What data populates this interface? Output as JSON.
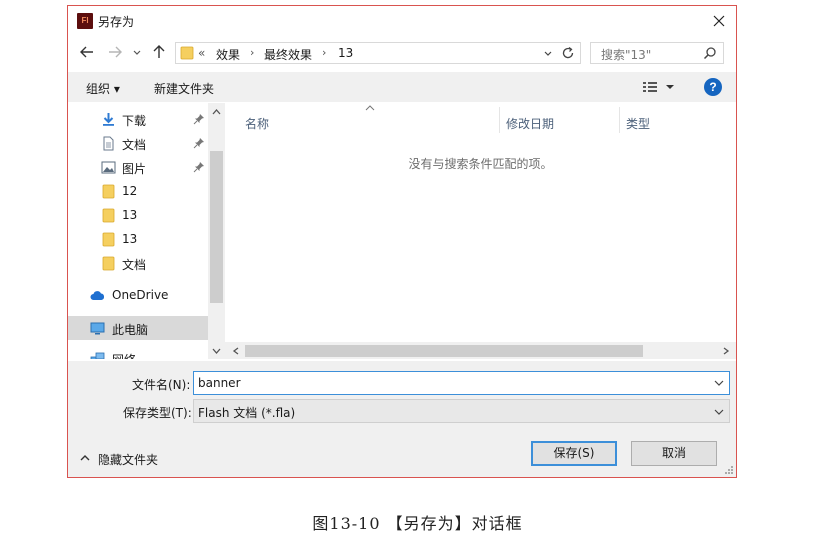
{
  "window": {
    "title": "另存为",
    "app_icon_text": "Fl"
  },
  "nav": {
    "breadcrumb": [
      "效果",
      "最终效果",
      "13"
    ],
    "breadcrumb_overflow": "«",
    "search_placeholder": "搜索\"13\""
  },
  "toolbar": {
    "organize_label": "组织 ▾",
    "new_folder_label": "新建文件夹"
  },
  "sidebar": {
    "items": [
      {
        "label": "下载",
        "icon": "download-icon",
        "pinned": true
      },
      {
        "label": "文档",
        "icon": "document-icon",
        "pinned": true
      },
      {
        "label": "图片",
        "icon": "picture-icon",
        "pinned": true
      },
      {
        "label": "12",
        "icon": "folder-icon",
        "pinned": false
      },
      {
        "label": "13",
        "icon": "folder-icon",
        "pinned": false
      },
      {
        "label": "13",
        "icon": "folder-icon",
        "pinned": false
      },
      {
        "label": "文档",
        "icon": "folder-icon",
        "pinned": false
      },
      {
        "label": "OneDrive",
        "icon": "cloud-icon",
        "pinned": false
      },
      {
        "label": "此电脑",
        "icon": "computer-icon",
        "pinned": false,
        "selected": true
      },
      {
        "label": "网络",
        "icon": "network-icon",
        "pinned": false
      }
    ]
  },
  "file_list": {
    "columns": [
      "名称",
      "修改日期",
      "类型"
    ],
    "empty_message": "没有与搜索条件匹配的项。"
  },
  "form": {
    "filename_label": "文件名(N):",
    "filename_value": "banner",
    "filetype_label": "保存类型(T):",
    "filetype_value": "Flash 文档 (*.fla)",
    "hide_folders_label": "隐藏文件夹",
    "save_label": "保存(S)",
    "cancel_label": "取消"
  },
  "caption": "图13-10 【另存为】对话框",
  "colors": {
    "accent": "#3c8fd9",
    "dialog_border": "#d9534f",
    "help": "#1565c0",
    "folder": "#f5cf5f"
  }
}
